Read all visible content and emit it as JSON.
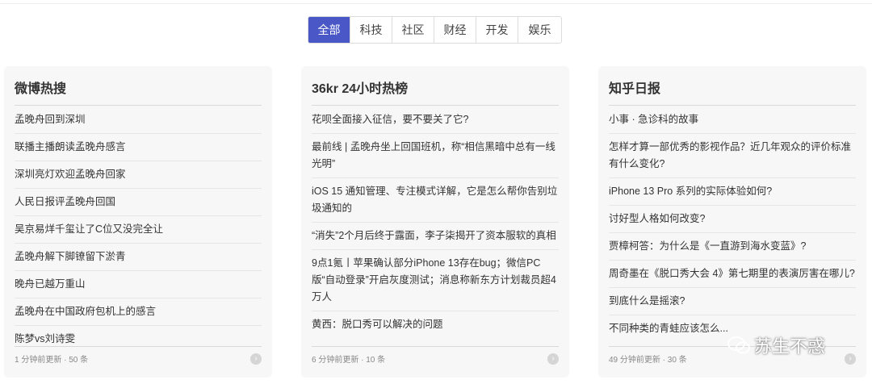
{
  "tabs": [
    {
      "label": "全部",
      "active": true
    },
    {
      "label": "科技",
      "active": false
    },
    {
      "label": "社区",
      "active": false
    },
    {
      "label": "财经",
      "active": false
    },
    {
      "label": "开发",
      "active": false
    },
    {
      "label": "娱乐",
      "active": false
    }
  ],
  "cards": [
    {
      "title": "微博热搜",
      "items": [
        "孟晚舟回到深圳",
        "联播主播朗读孟晚舟感言",
        "深圳亮灯欢迎孟晚舟回家",
        "人民日报评孟晚舟回国",
        "吴京易烊千玺让了C位又没完全让",
        "孟晚舟解下脚镣留下淤青",
        "晚舟已越万重山",
        "孟晚舟在中国政府包机上的感言",
        "陈梦vs刘诗雯"
      ],
      "footer": "1 分钟前更新 · 50 条"
    },
    {
      "title": "36kr 24小时热榜",
      "items": [
        "花呗全面接入征信，要不要关了它?",
        "最前线 | 孟晚舟坐上回国班机，称“相信黑暗中总有一线光明”",
        "iOS 15 通知管理、专注模式详解，它是怎么帮你告别垃圾通知的",
        "“消失”2个月后终于露面，李子柒揭开了资本服软的真相",
        "9点1氪丨苹果确认部分iPhone 13存在bug；微信PC版“自动登录”开启灰度测试；消息称新东方计划裁员超4万人",
        "黄西：脱口秀可以解决的问题"
      ],
      "footer": "6 分钟前更新 · 10 条"
    },
    {
      "title": "知乎日报",
      "items": [
        "小事 · 急诊科的故事",
        "怎样才算一部优秀的影视作品？近几年观众的评价标准有什么变化?",
        "iPhone 13 Pro 系列的实际体验如何?",
        "讨好型人格如何改变?",
        "贾樟柯答：为什么是《一直游到海水变蓝》?",
        "周奇墨在《脱口秀大会 4》第七期里的表演厉害在哪儿?",
        "到底什么是摇滚?",
        "不同种类的青蛙应该怎么..."
      ],
      "footer": "49 分钟前更新 · 30 条"
    }
  ],
  "watermark": "苏生不惑",
  "colors": {
    "accent": "#4a57c7",
    "card_bg": "#f7f7f7"
  }
}
